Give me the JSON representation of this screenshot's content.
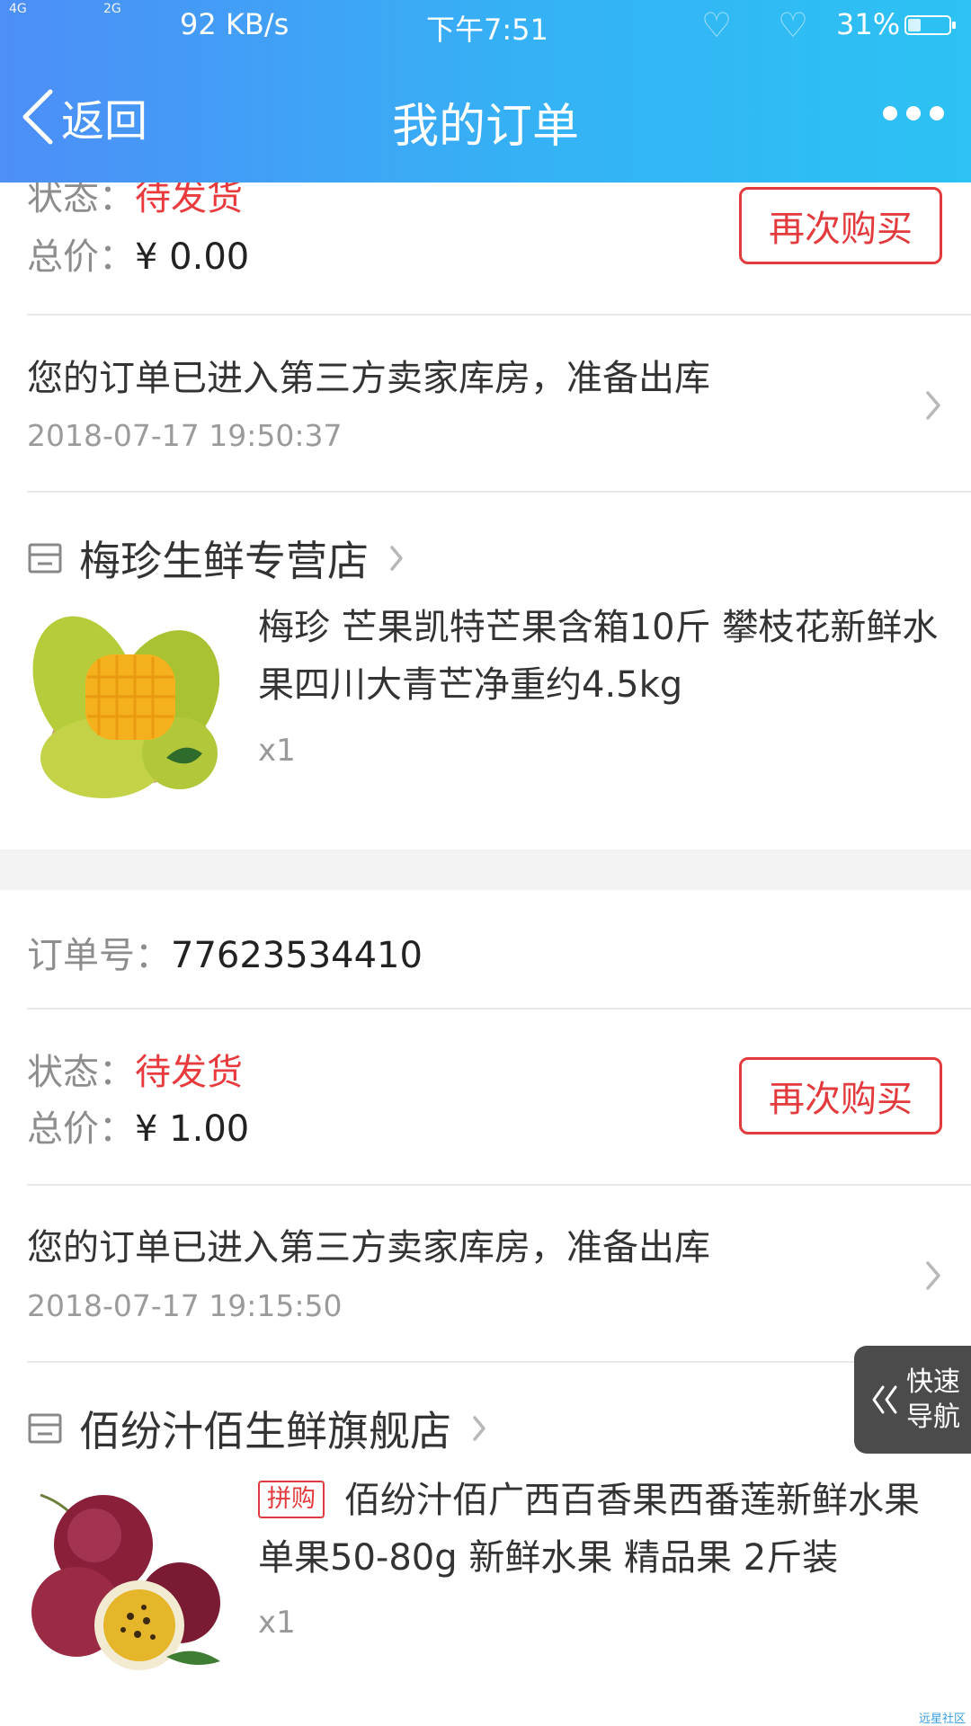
{
  "status_bar": {
    "network_1": "4G",
    "network_2": "2G",
    "speed": "92 KB/s",
    "time": "下午7:51",
    "battery": "31%",
    "battery_level": 0.31
  },
  "nav": {
    "back_label": "返回",
    "title": "我的订单"
  },
  "orders": [
    {
      "status_label": "状态：",
      "status_value": "待发货",
      "total_label": "总价：",
      "total_value": "¥ 0.00",
      "rebuy_label": "再次购买",
      "tracking_text": "您的订单已进入第三方卖家库房，准备出库",
      "tracking_time": "2018-07-17 19:50:37",
      "shop_name": "梅珍生鲜专营店",
      "product_title": "梅珍 芒果凯特芒果含箱10斤 攀枝花新鲜水果四川大青芒净重约4.5kg",
      "qty": "x1"
    },
    {
      "order_no_label": "订单号：",
      "order_no": "77623534410",
      "status_label": "状态：",
      "status_value": "待发货",
      "total_label": "总价：",
      "total_value": "¥ 1.00",
      "rebuy_label": "再次购买",
      "tracking_text": "您的订单已进入第三方卖家库房，准备出库",
      "tracking_time": "2018-07-17 19:15:50",
      "shop_name": "佰纷汁佰生鲜旗舰店",
      "product_tag": "拼购",
      "product_title": "佰纷汁佰广西百香果西番莲新鲜水果单果50-80g 新鲜水果 精品果 2斤装",
      "qty": "x1"
    }
  ],
  "quick_nav": {
    "line1": "快速",
    "line2": "导航"
  },
  "watermark": "远星社区",
  "colors": {
    "accent_red": "#e33b3d",
    "header_start": "#4d8ef7",
    "header_end": "#2cc2f3"
  }
}
